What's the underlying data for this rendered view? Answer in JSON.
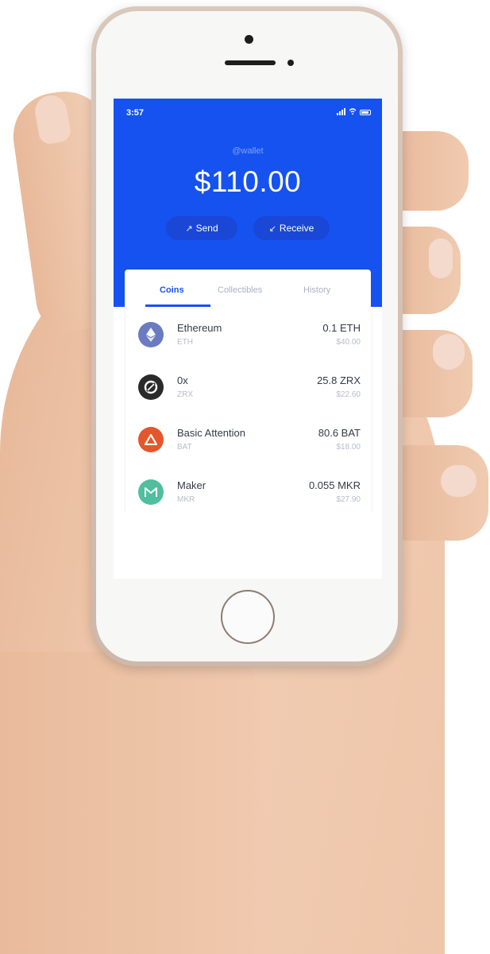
{
  "status_bar": {
    "time": "3:57"
  },
  "wallet": {
    "name": "@wallet",
    "balance": "$110.00",
    "send_label": "Send",
    "receive_label": "Receive"
  },
  "tabs": [
    {
      "label": "Coins",
      "active": true
    },
    {
      "label": "Collectibles",
      "active": false
    },
    {
      "label": "History",
      "active": false
    }
  ],
  "coins": [
    {
      "name": "Ethereum",
      "symbol": "ETH",
      "amount": "0.1 ETH",
      "value": "$40.00",
      "icon": "ethereum-icon"
    },
    {
      "name": "0x",
      "symbol": "ZRX",
      "amount": "25.8 ZRX",
      "value": "$22.60",
      "icon": "zrx-icon"
    },
    {
      "name": "Basic Attention",
      "symbol": "BAT",
      "amount": "80.6 BAT",
      "value": "$18.00",
      "icon": "bat-icon"
    },
    {
      "name": "Maker",
      "symbol": "MKR",
      "amount": "0.055 MKR",
      "value": "$27.90",
      "icon": "maker-icon"
    }
  ],
  "colors": {
    "brand_blue": "#1652f0",
    "eth": "#6b7bc1",
    "zrx": "#2a2a2a",
    "bat": "#e4562c",
    "mkr": "#4fbfa0"
  }
}
